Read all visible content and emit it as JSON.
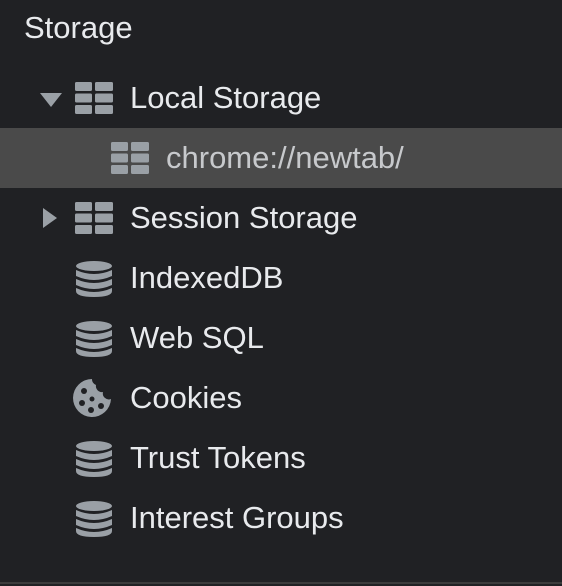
{
  "section": {
    "title": "Storage"
  },
  "tree": [
    {
      "label": "Local Storage",
      "icon": "table-grid-icon",
      "expanded": true
    },
    {
      "label": "chrome://newtab/",
      "icon": "table-grid-icon",
      "selected": true
    },
    {
      "label": "Session Storage",
      "icon": "table-grid-icon",
      "expanded": false
    },
    {
      "label": "IndexedDB",
      "icon": "database-icon"
    },
    {
      "label": "Web SQL",
      "icon": "database-icon"
    },
    {
      "label": "Cookies",
      "icon": "cookie-icon"
    },
    {
      "label": "Trust Tokens",
      "icon": "database-icon"
    },
    {
      "label": "Interest Groups",
      "icon": "database-icon"
    }
  ],
  "colors": {
    "background": "#202124",
    "text": "#e8eaed",
    "icon": "#9aa0a6",
    "selected_row": "#4a4a4a"
  }
}
